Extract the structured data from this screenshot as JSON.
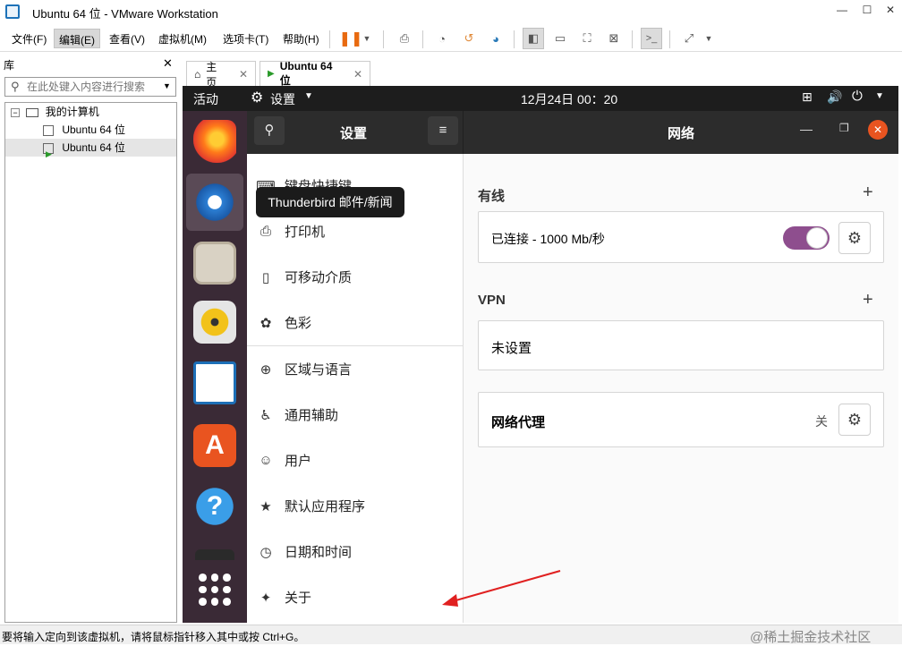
{
  "window": {
    "title": "Ubuntu 64 位 - VMware Workstation"
  },
  "menu": [
    "文件(F)",
    "编辑(E)",
    "查看(V)",
    "虚拟机(M)",
    "选项卡(T)",
    "帮助(H)"
  ],
  "library": {
    "title": "库",
    "search_placeholder": "在此处键入内容进行搜索",
    "tree": [
      {
        "label": "我的计算机"
      },
      {
        "label": "Ubuntu 64 位"
      },
      {
        "label": "Ubuntu 64 位"
      }
    ]
  },
  "tabs": [
    {
      "label": "主页"
    },
    {
      "label": "Ubuntu 64 位"
    }
  ],
  "ubuntu": {
    "activities": "活动",
    "app_menu": "设置",
    "clock": "12月24日 00：20",
    "tooltip": "Thunderbird 邮件/新闻",
    "settings_title": "设置",
    "page_title": "网络",
    "sidebar": [
      {
        "label": "键盘快捷键",
        "icon": "keyboard-icon"
      },
      {
        "label": "打印机",
        "icon": "printer-icon"
      },
      {
        "label": "可移动介质",
        "icon": "removable-media-icon"
      },
      {
        "label": "色彩",
        "icon": "color-icon"
      },
      {
        "label": "区域与语言",
        "icon": "globe-icon"
      },
      {
        "label": "通用辅助",
        "icon": "accessibility-icon"
      },
      {
        "label": "用户",
        "icon": "users-icon"
      },
      {
        "label": "默认应用程序",
        "icon": "star-icon"
      },
      {
        "label": "日期和时间",
        "icon": "clock-icon"
      },
      {
        "label": "关于",
        "icon": "sparkle-icon"
      }
    ],
    "wired": {
      "title": "有线",
      "status": "已连接 - 1000 Mb/秒",
      "toggle_on": true
    },
    "vpn": {
      "title": "VPN",
      "status": "未设置"
    },
    "proxy": {
      "title": "网络代理",
      "value": "关"
    }
  },
  "status_bar": {
    "text": "要将输入定向到该虚拟机，请将鼠标指针移入其中或按 Ctrl+G。",
    "watermark": "@稀土掘金技术社区"
  },
  "colors": {
    "accent": "#e95420",
    "toggle": "#8e4e8e",
    "dock": "#3a2a36",
    "arrow": "#e02020"
  }
}
